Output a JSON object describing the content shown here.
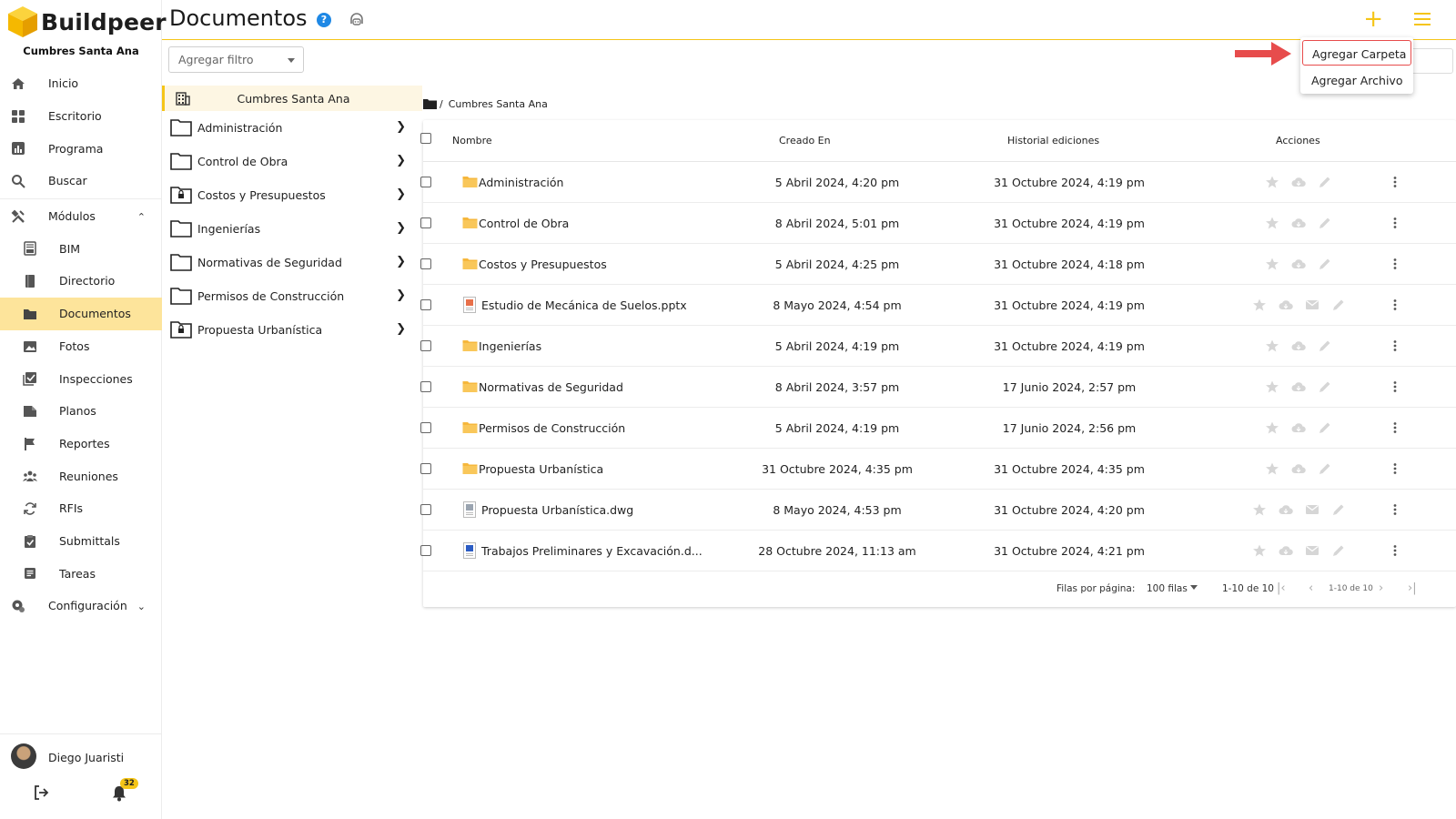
{
  "brand": {
    "name": "Buildpeer",
    "project": "Cumbres Santa Ana"
  },
  "nav": [
    {
      "label": "Inicio",
      "icon": "home-icon"
    },
    {
      "label": "Escritorio",
      "icon": "dashboard-icon"
    },
    {
      "label": "Programa",
      "icon": "chart-icon"
    },
    {
      "label": "Buscar",
      "icon": "search-icon"
    },
    {
      "label": "Módulos",
      "icon": "tools-icon",
      "expanded": true
    },
    {
      "label": "BIM",
      "icon": "bim-icon"
    },
    {
      "label": "Directorio",
      "icon": "book-icon"
    },
    {
      "label": "Documentos",
      "icon": "folder-icon",
      "active": true
    },
    {
      "label": "Fotos",
      "icon": "image-icon"
    },
    {
      "label": "Inspecciones",
      "icon": "checklist-icon"
    },
    {
      "label": "Planos",
      "icon": "plan-icon"
    },
    {
      "label": "Reportes",
      "icon": "flag-icon"
    },
    {
      "label": "Reuniones",
      "icon": "group-icon"
    },
    {
      "label": "RFIs",
      "icon": "sync-icon"
    },
    {
      "label": "Submittals",
      "icon": "clipboard-check-icon"
    },
    {
      "label": "Tareas",
      "icon": "task-icon"
    },
    {
      "label": "Configuración",
      "icon": "settings-icon"
    }
  ],
  "user": {
    "name": "Diego Juaristi",
    "notifications": "32"
  },
  "header": {
    "title": "Documentos"
  },
  "filter": {
    "placeholder": "Agregar filtro"
  },
  "tree": {
    "root": "Cumbres Santa Ana",
    "items": [
      {
        "label": "Administración",
        "locked": false
      },
      {
        "label": "Control de Obra",
        "locked": false
      },
      {
        "label": "Costos y Presupuestos",
        "locked": true
      },
      {
        "label": "Ingenierías",
        "locked": false
      },
      {
        "label": "Normativas de Seguridad",
        "locked": false
      },
      {
        "label": "Permisos de Construcción",
        "locked": false
      },
      {
        "label": "Propuesta Urbanística",
        "locked": true
      }
    ]
  },
  "breadcrumb": {
    "sep": "/",
    "current": "Cumbres Santa Ana"
  },
  "table": {
    "columns": {
      "name": "Nombre",
      "created": "Creado En",
      "edited": "Historial ediciones",
      "actions": "Acciones"
    },
    "rows": [
      {
        "name": "Administración",
        "type": "folder",
        "created": "5 Abril 2024, 4:20 pm",
        "edited": "31 Octubre 2024, 4:19 pm"
      },
      {
        "name": "Control de Obra",
        "type": "folder",
        "created": "8 Abril 2024, 5:01 pm",
        "edited": "31 Octubre 2024, 4:19 pm"
      },
      {
        "name": "Costos y Presupuestos",
        "type": "folder",
        "created": "5 Abril 2024, 4:25 pm",
        "edited": "31 Octubre 2024, 4:18 pm"
      },
      {
        "name": "Estudio de Mecánica de Suelos.pptx",
        "type": "pptx",
        "created": "8 Mayo 2024, 4:54 pm",
        "edited": "31 Octubre 2024, 4:19 pm"
      },
      {
        "name": "Ingenierías",
        "type": "folder",
        "created": "5 Abril 2024, 4:19 pm",
        "edited": "31 Octubre 2024, 4:19 pm"
      },
      {
        "name": "Normativas de Seguridad",
        "type": "folder",
        "created": "8 Abril 2024, 3:57 pm",
        "edited": "17 Junio 2024, 2:57 pm"
      },
      {
        "name": "Permisos de Construcción",
        "type": "folder",
        "created": "5 Abril 2024, 4:19 pm",
        "edited": "17 Junio 2024, 2:56 pm"
      },
      {
        "name": "Propuesta Urbanística",
        "type": "folder",
        "created": "31 Octubre 2024, 4:35 pm",
        "edited": "31 Octubre 2024, 4:35 pm"
      },
      {
        "name": "Propuesta Urbanística.dwg",
        "type": "dwg",
        "created": "8 Mayo 2024, 4:53 pm",
        "edited": "31 Octubre 2024, 4:20 pm"
      },
      {
        "name": "Trabajos Preliminares y Excavación.d...",
        "type": "docx",
        "created": "28 Octubre 2024, 11:13 am",
        "edited": "31 Octubre 2024, 4:21 pm"
      }
    ]
  },
  "pagination": {
    "rows_per_page_label": "Filas por página:",
    "rows_per_page_value": "100 filas",
    "range": "1-10 de 10",
    "range_small": "1-10 de 10"
  },
  "menu": {
    "add_folder": "Agregar Carpeta",
    "add_file": "Agregar Archivo"
  },
  "colors": {
    "accent": "#f5c518",
    "active_bg": "#fde49b",
    "folder": "#f6b73c",
    "arrow": "#e74c4c"
  }
}
